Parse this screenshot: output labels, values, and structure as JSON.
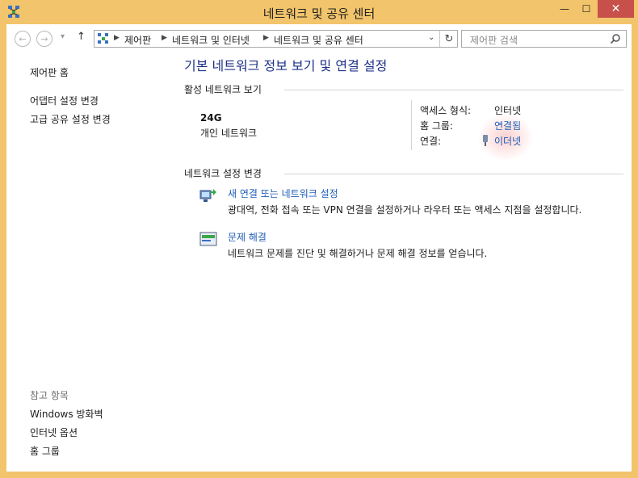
{
  "window": {
    "title": "네트워크 및 공유 센터",
    "controls": {
      "minimize": "—",
      "maximize": "☐",
      "close": "✕"
    }
  },
  "navbar": {
    "back": "←",
    "forward": "→",
    "recent": "▾",
    "up": "↑",
    "breadcrumbs": [
      "제어판",
      "네트워크 및 인터넷",
      "네트워크 및 공유 센터"
    ],
    "separator": "▶",
    "dropdown": "⌄",
    "refresh": "↻",
    "search_placeholder": "제어판 검색"
  },
  "sidebar": {
    "home": "제어판 홈",
    "links": [
      "어댑터 설정 변경",
      "고급 공유 설정 변경"
    ],
    "see_also_heading": "참고 항목",
    "see_also": [
      "Windows 방화벽",
      "인터넷 옵션",
      "홈 그룹"
    ]
  },
  "main": {
    "title": "기본 네트워크 정보 보기 및 연결 설정",
    "active_section": "활성 네트워크 보기",
    "network": {
      "name": "24G",
      "type": "개인 네트워크",
      "access_label": "액세스 형식:",
      "access_value": "인터넷",
      "homegroup_label": "홈 그룹:",
      "homegroup_value": "연결됨",
      "connection_label": "연결:",
      "connection_value": "이더넷"
    },
    "change_section": "네트워크 설정 변경",
    "tasks": [
      {
        "link": "새 연결 또는 네트워크 설정",
        "desc": "광대역, 전화 접속 또는 VPN 연결을 설정하거나 라우터 또는 액세스 지점을 설정합니다."
      },
      {
        "link": "문제 해결",
        "desc": "네트워크 문제를 진단 및 해결하거나 문제 해결 정보를 얻습니다."
      }
    ]
  },
  "colors": {
    "frame": "#f2c46b",
    "link": "#1f5db8",
    "title": "#1e3287",
    "close": "#c7504a"
  }
}
